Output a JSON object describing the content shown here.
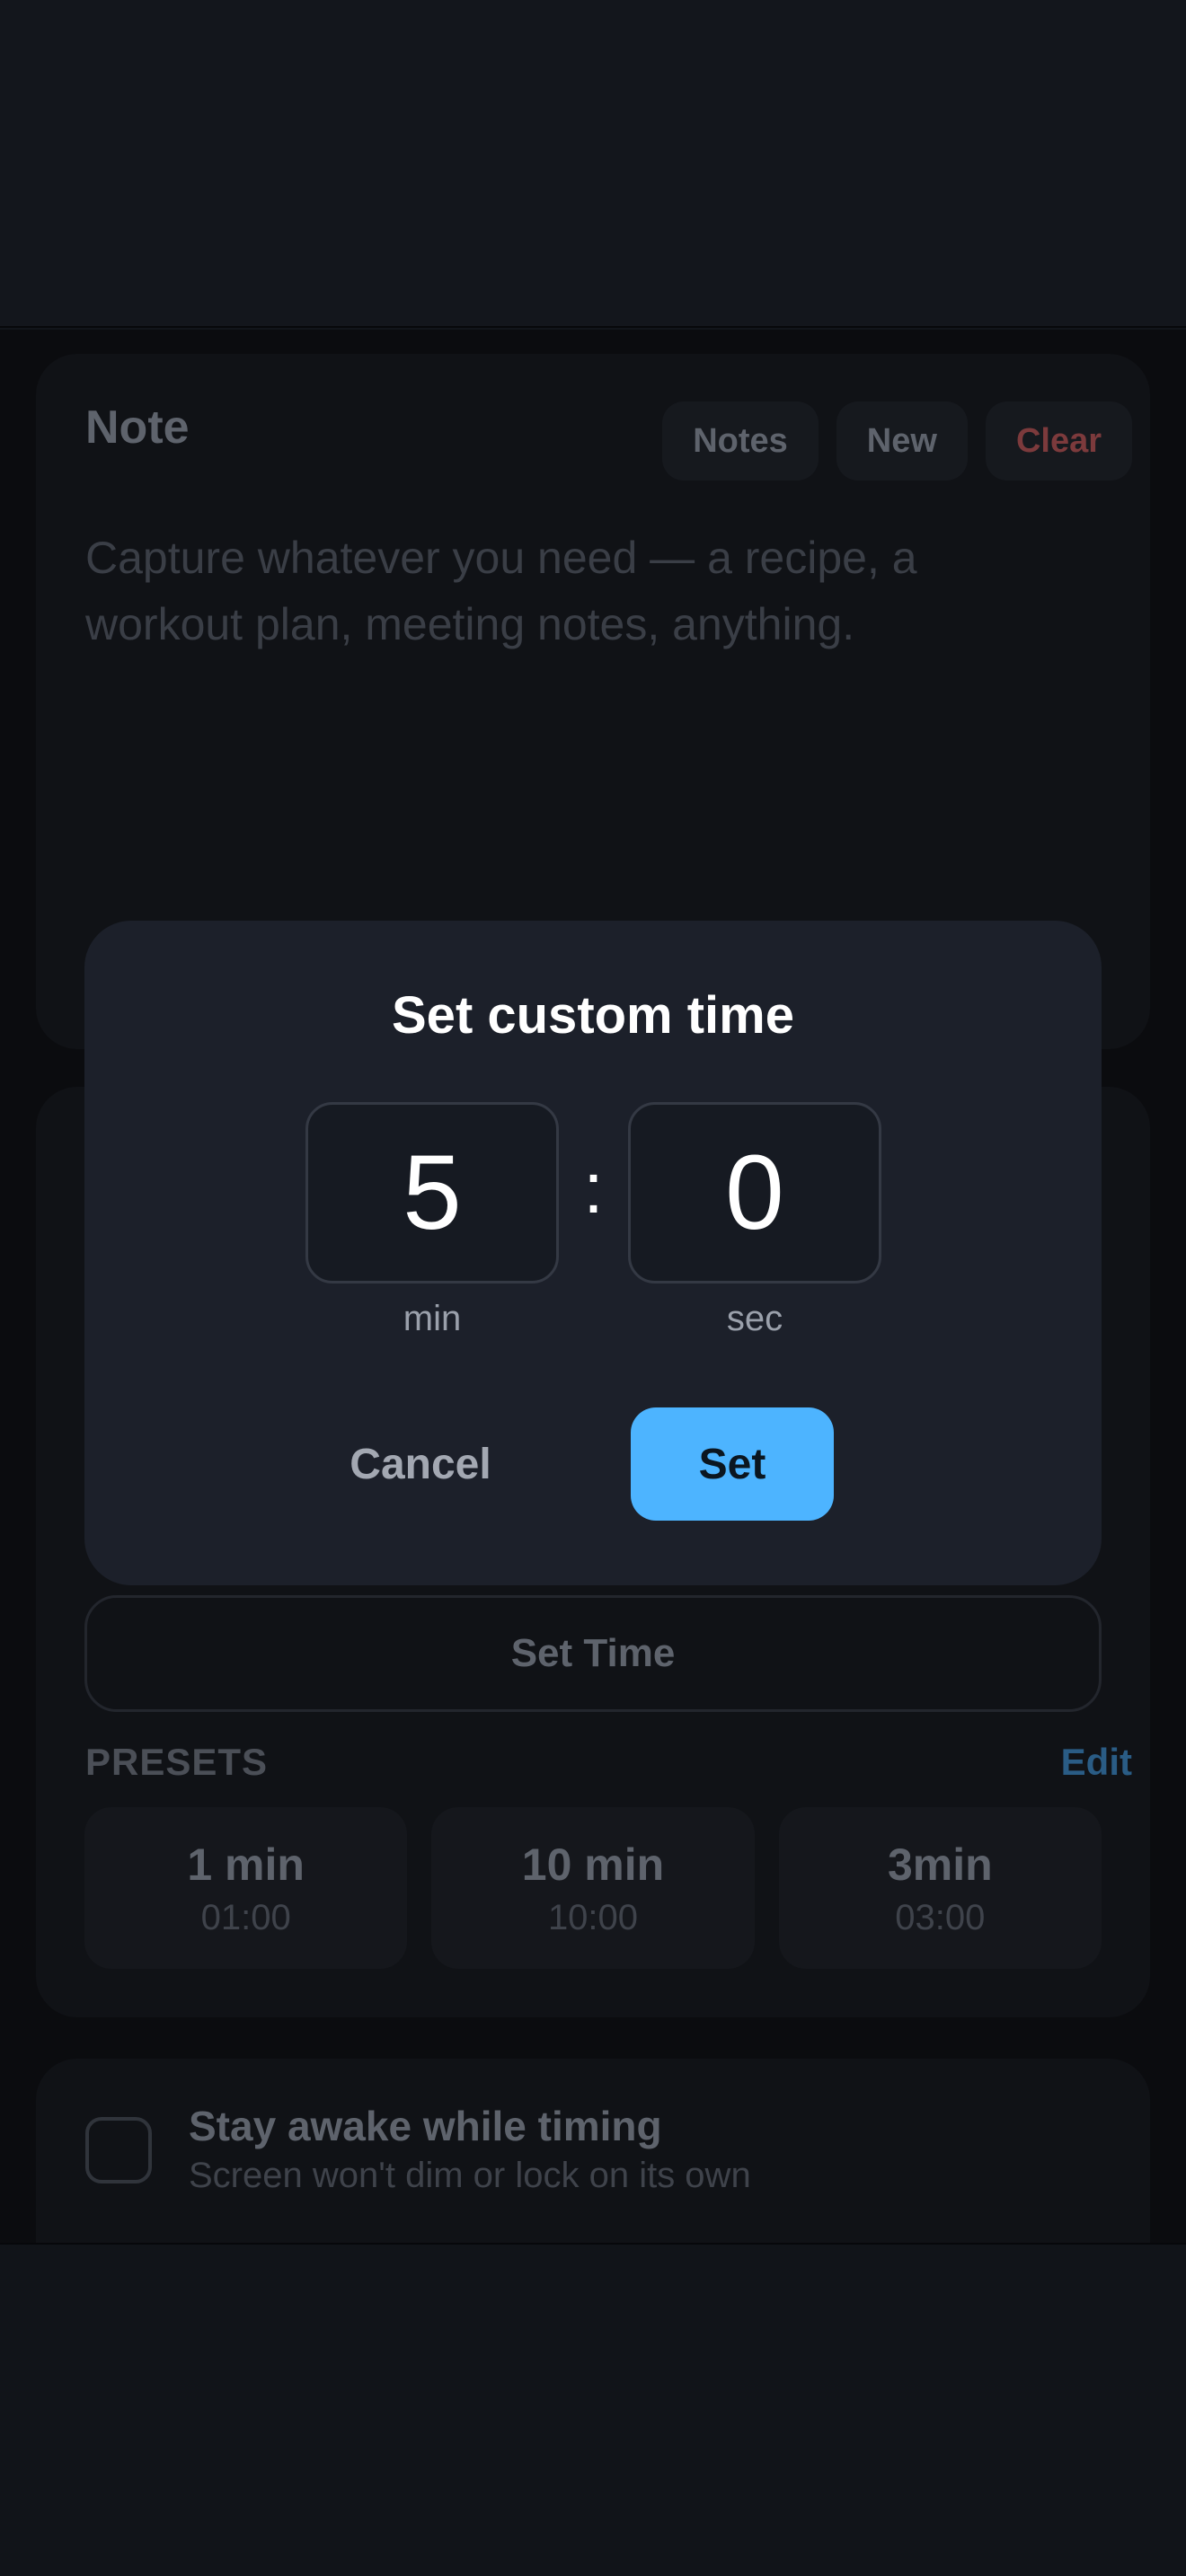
{
  "note": {
    "title": "Note",
    "actions": {
      "notes": "Notes",
      "new": "New",
      "clear": "Clear"
    },
    "placeholder": "Capture whatever you need — a recipe, a workout plan, meeting notes, anything."
  },
  "timer": {
    "set_time_label": "Set Time",
    "presets_label": "PRESETS",
    "edit_label": "Edit",
    "presets": [
      {
        "name": "1 min",
        "time": "01:00"
      },
      {
        "name": "10 min",
        "time": "10:00"
      },
      {
        "name": "3min",
        "time": "03:00"
      }
    ]
  },
  "stay_awake": {
    "title": "Stay awake while timing",
    "subtitle": "Screen won't dim or lock on its own"
  },
  "modal": {
    "title": "Set custom time",
    "minutes": "5",
    "seconds": "0",
    "separator": ":",
    "min_label": "min",
    "sec_label": "sec",
    "cancel_label": "Cancel",
    "set_label": "Set"
  },
  "colors": {
    "accent": "#4db4ff",
    "danger": "#7c3a3c",
    "link": "#2a5c85",
    "modal_bg": "#1c202a"
  }
}
